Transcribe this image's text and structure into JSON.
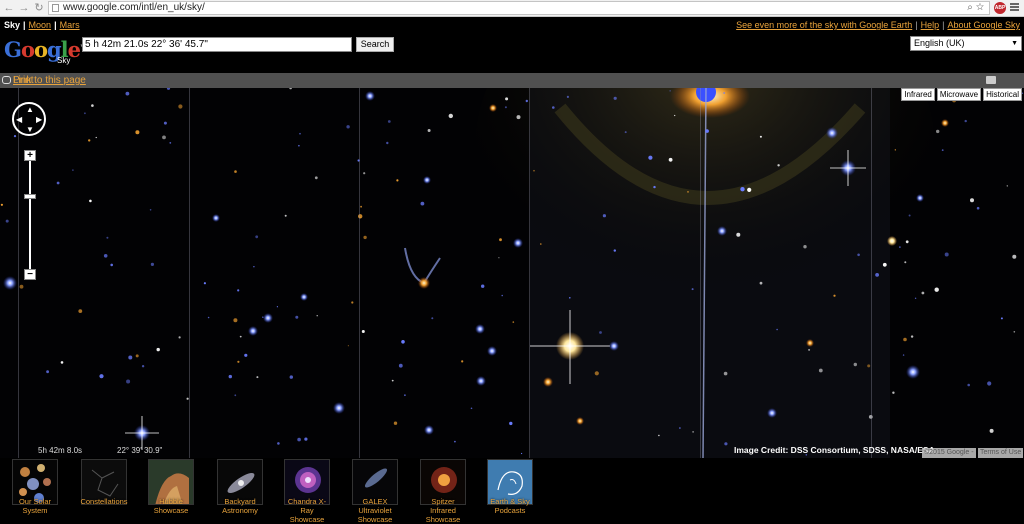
{
  "browser": {
    "url": "www.google.com/intl/en_uk/sky/",
    "back_icon": "back-arrow-icon",
    "forward_icon": "forward-arrow-icon",
    "reload_icon": "reload-icon"
  },
  "topnav": {
    "current": "Sky",
    "links": [
      "Moon",
      "Mars"
    ],
    "right_links": [
      "See even more of the sky with Google Earth",
      "Help",
      "About Google Sky"
    ]
  },
  "header": {
    "logo_letters": [
      "G",
      "o",
      "o",
      "g",
      "l",
      "e"
    ],
    "logo_tm": "™",
    "logo_sub": "Sky",
    "search_value": "5 h 42m 21.0s 22° 36' 45.7\"",
    "search_button": "Search",
    "language": "English (UK)"
  },
  "linkbar": {
    "link_text": "Link to this page",
    "print_text": "Print"
  },
  "map": {
    "layers": [
      "Infrared",
      "Microwave",
      "Historical"
    ],
    "zoom_in": "+",
    "zoom_out": "−",
    "coord_ra": "5h 42m 8.0s",
    "coord_dec": "22° 39' 30.9\"",
    "credit": "Image Credit: DSS Consortium, SDSS, NASA/ESA",
    "copyright": "©2015 Google -",
    "terms": "Terms of Use"
  },
  "showcase": [
    {
      "label": "Our Solar System",
      "line1": "Our Solar",
      "line2": "System"
    },
    {
      "label": "Constellations",
      "line1": "Constellations",
      "line2": ""
    },
    {
      "label": "Hubble Showcase",
      "line1": "Hubble",
      "line2": "Showcase"
    },
    {
      "label": "Backyard Astronomy",
      "line1": "Backyard",
      "line2": "Astronomy"
    },
    {
      "label": "Chandra X-Ray Showcase",
      "line1": "Chandra X-",
      "line2": "Ray"
    },
    {
      "label": "GALEX Ultraviolet Showcase",
      "line1": "GALEX",
      "line2": "Ultraviolet"
    },
    {
      "label": "Spitzer Infrared Showcase",
      "line1": "Spitzer",
      "line2": "Infrared"
    },
    {
      "label": "Earth & Sky Podcasts",
      "line1": "Earth & Sky",
      "line2": "Podcasts"
    }
  ],
  "showcase_line3": [
    "",
    "",
    "",
    "",
    "Showcase",
    "Showcase",
    "Showcase",
    ""
  ],
  "colors": {
    "link": "#e8a33c",
    "linkbar_bg": "#505050",
    "star_blue": "#4a63ff",
    "star_orange": "#f0a030"
  }
}
